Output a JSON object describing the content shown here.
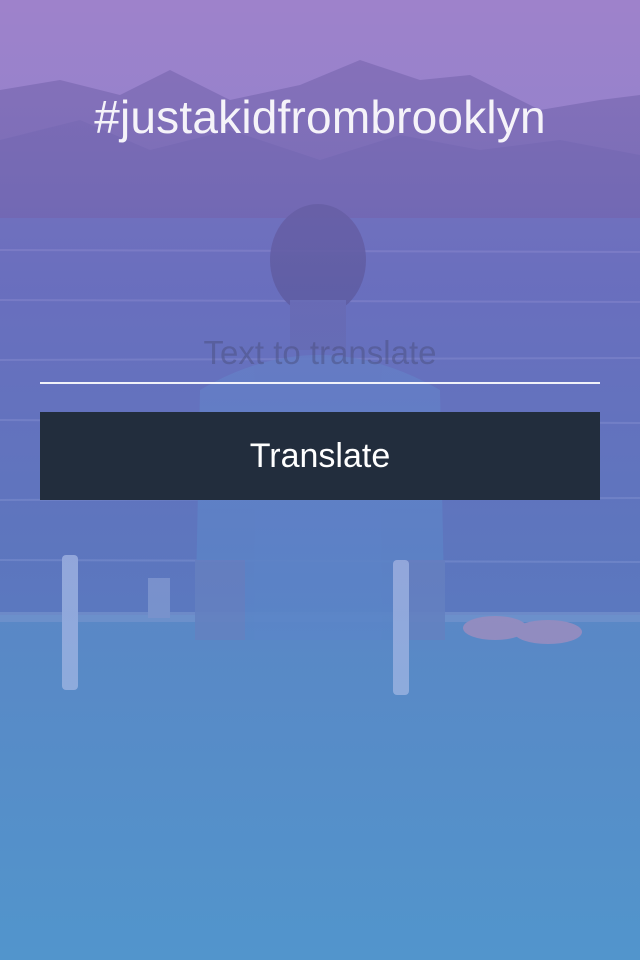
{
  "app": {
    "title": "#justakidfrombrooklyn"
  },
  "form": {
    "input_placeholder": "Text to translate",
    "input_value": "",
    "button_label": "Translate"
  },
  "colors": {
    "button_bg": "#222d3d",
    "gradient_top": "#8f86c9",
    "gradient_bottom": "#43a2d6"
  }
}
